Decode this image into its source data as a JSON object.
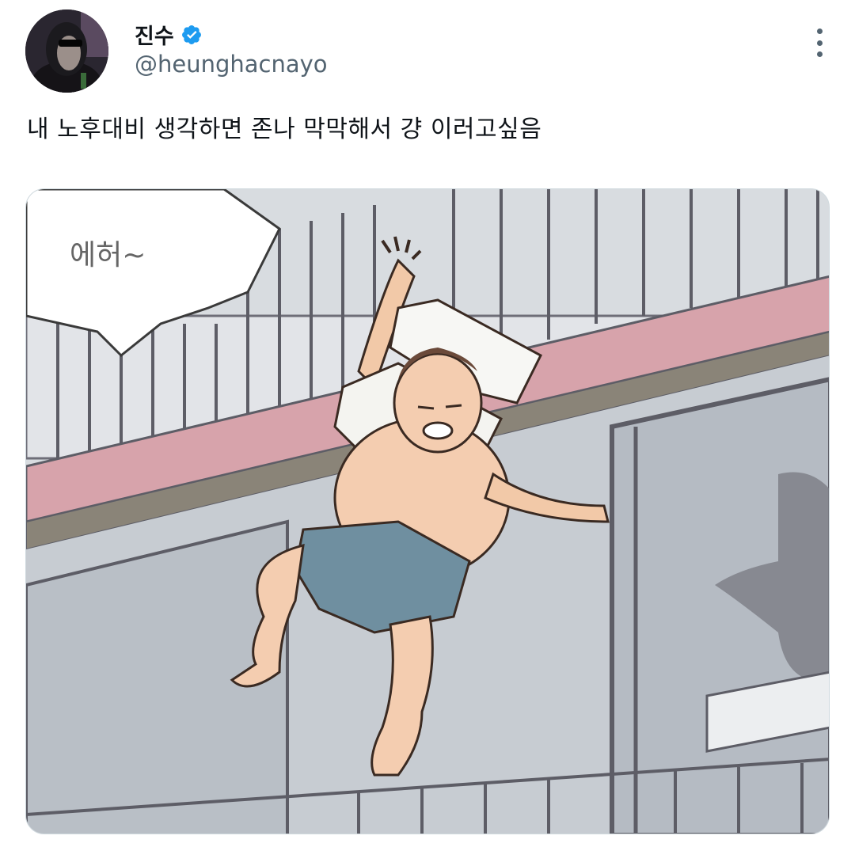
{
  "tweet": {
    "display_name": "진수",
    "handle": "@heunghacnayo",
    "text": "내 노후대비 생각하면 존나 막막해서 걍 이러고싶음",
    "verified": true,
    "avatar_icon": "avatar-character-icon",
    "more_icon": "more-options-icon"
  },
  "media": {
    "speech_bubble_text": "에허~"
  },
  "colors": {
    "verified_blue": "#1d9bf0",
    "text_primary": "#0f1419",
    "text_secondary": "#536471",
    "railing_pink": "#d7a3ab"
  }
}
